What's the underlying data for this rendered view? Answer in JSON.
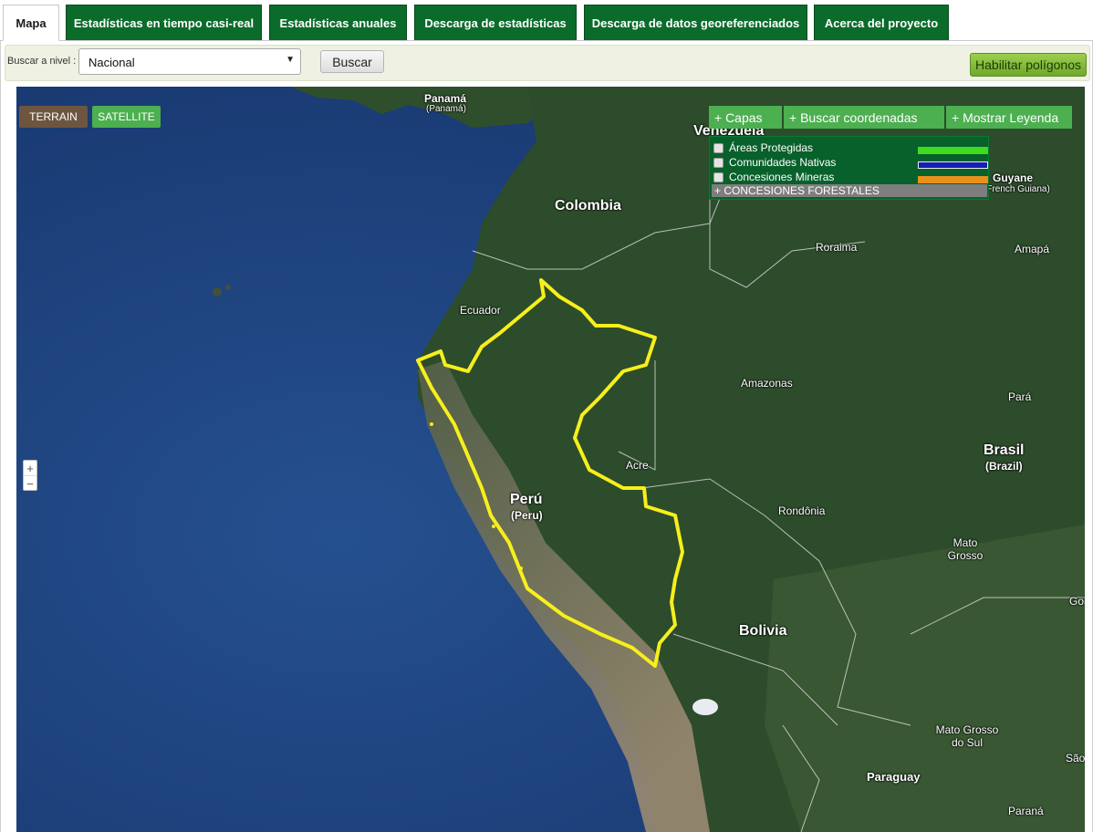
{
  "tabs": [
    {
      "label": "Mapa",
      "active": true
    },
    {
      "label": "Estadísticas en tiempo casi-real"
    },
    {
      "label": "Estadísticas anuales"
    },
    {
      "label": "Descarga de estadísticas"
    },
    {
      "label": "Descarga de datos georeferenciados"
    },
    {
      "label": "Acerca del proyecto"
    }
  ],
  "search": {
    "level_label": "Buscar a nivel :",
    "level_value": "Nacional",
    "search_button": "Buscar",
    "polygons_button": "Habilitar polígonos"
  },
  "map": {
    "map_types": {
      "terrain": "TERRAIN",
      "satellite": "SATELLITE"
    },
    "zoom": {
      "plus": "+",
      "minus": "−"
    },
    "controls": {
      "capas": "+ Capas",
      "buscar_coordenadas": "+ Buscar coordenadas",
      "mostrar_leyenda": "+ Mostrar Leyenda"
    },
    "layers": [
      {
        "label": "Áreas Protegidas",
        "color": "#3ddc1e"
      },
      {
        "label": "Comunidades Nativas",
        "color": "#1420b4"
      },
      {
        "label": "Concesiones Mineras",
        "color": "#e8901a"
      }
    ],
    "forestales": "+ CONCESIONES FORESTALES",
    "places": {
      "panama": "Panamá",
      "panama_local": "(Panamá)",
      "venezuela": "Venezuela",
      "colombia": "Colombia",
      "guyane": "Guyane",
      "guyane_local": "(French Guiana)",
      "roraima": "Roraima",
      "amapa": "Amapá",
      "ecuador": "Ecuador",
      "amazonas": "Amazonas",
      "para": "Pará",
      "brasil": "Brasil",
      "brasil_local": "(Brazil)",
      "acre": "Acre",
      "peru": "Perú",
      "peru_local": "(Peru)",
      "rondonia": "Rondônia",
      "mato_grosso": "Mato Grosso",
      "goias": "Goiás",
      "bolivia": "Bolivia",
      "mato_grosso_sul": "Mato Grosso do Sul",
      "sao": "São",
      "paraguay": "Paraguay",
      "parana": "Paraná"
    },
    "colors": {
      "ocean": "#1d3f80",
      "land": "#2b4f2a",
      "peru_border": "#f6ef1c"
    }
  }
}
